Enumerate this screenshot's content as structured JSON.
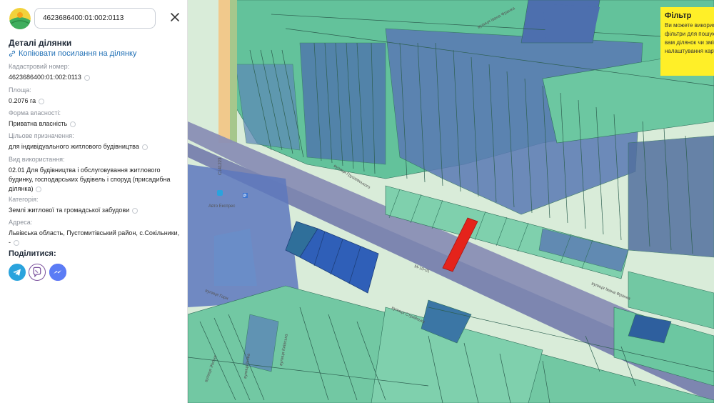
{
  "search": {
    "value": "4623686400:01:002:0113"
  },
  "details": {
    "title": "Деталі ділянки",
    "copy_link": "Копіювати посилання на ділянку"
  },
  "fields": {
    "cadastral": {
      "label": "Кадастровий номер:",
      "value": "4623686400:01:002:0113"
    },
    "area": {
      "label": "Площа:",
      "value": "0.2076 га"
    },
    "ownership": {
      "label": "Форма власності:",
      "value": "Приватна власність"
    },
    "purpose": {
      "label": "Цільове призначення:",
      "value": "для індивідуального житлового будівництва"
    },
    "usage": {
      "label": "Вид використання:",
      "value": "02.01 Для будівництва і обслуговування житлового будинку, господарських будівель і споруд (присадибна ділянка)"
    },
    "category": {
      "label": "Категорія:",
      "value": "Землі житлової та громадської забудови"
    },
    "address": {
      "label": "Адреса:",
      "value": "Львівська область, Пустомитівський район, с.Сокільники, -"
    }
  },
  "share": {
    "title": "Поділитися:"
  },
  "filter": {
    "title": "Фільтр",
    "text": "Ви можете використовувати фільтри для пошуку необхідних вам ділянок чи змінювати налаштування карти"
  },
  "map_labels": {
    "road_code_1": "М-10-01",
    "road_code_2": "С141223",
    "street_franka": "вулиця Івана Франка",
    "street_franka_2": "вулиця Івана Франка",
    "street_stryiska": "вулиця Стрийська",
    "street_kyivska": "вулиця Київська",
    "street_hrushevskoho": "вулиця Грушевського",
    "street_zhytnia": "вулиця Житня",
    "street_hory": "вулиця Гори",
    "street_nova": "вулиця Нова",
    "street_skolivska": "вулиця Сколівська",
    "poi_hotel": "Авто Експрес"
  },
  "colors": {
    "highlight": "#e5231b",
    "parcel_green": "#5bc49a",
    "parcel_blue": "#4d6fae",
    "road": "#8a8fb5",
    "link": "#1f6fb5",
    "filter_bg": "#ffef28"
  }
}
